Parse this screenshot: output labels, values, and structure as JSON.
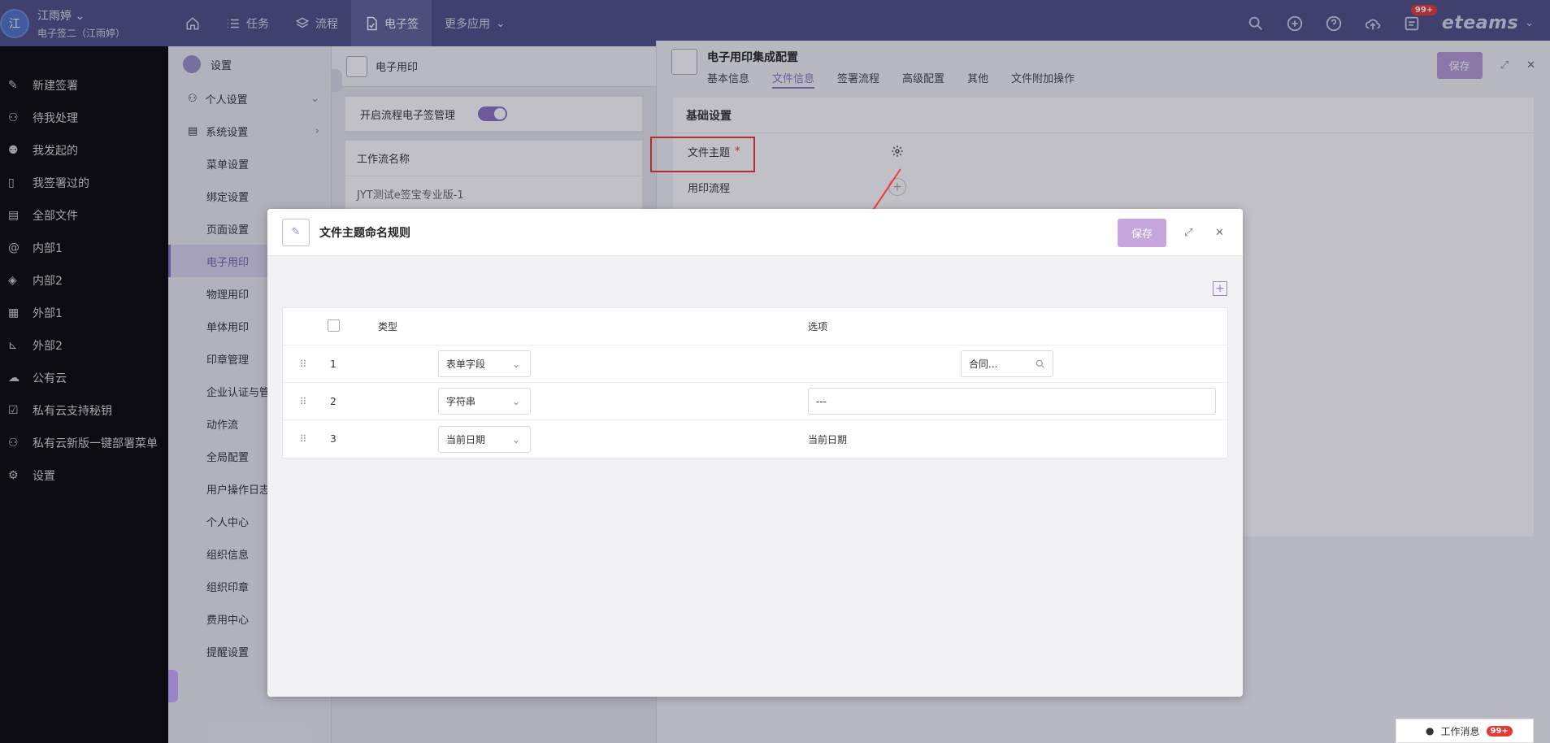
{
  "topbar": {
    "avatar_text": "江",
    "user_name": "江雨婷",
    "org": "电子签二（江雨婷）",
    "nav": [
      "任务",
      "流程",
      "电子签",
      "更多应用"
    ],
    "active_nav": "电子签",
    "badge": "99+",
    "brand": "eteams"
  },
  "sidebar": {
    "items": [
      "新建签署",
      "待我处理",
      "我发起的",
      "我签署过的",
      "全部文件",
      "内部1",
      "内部2",
      "外部1",
      "外部2",
      "公有云",
      "私有云支持秘钥",
      "私有云新版一键部署菜单",
      "设置"
    ]
  },
  "settings": {
    "title": "设置",
    "group_personal": "个人设置",
    "group_system": "系统设置",
    "subs": [
      "菜单设置",
      "绑定设置",
      "页面设置",
      "电子用印",
      "物理用印",
      "单体用印",
      "印章管理",
      "企业认证与管理",
      "动作流",
      "全局配置",
      "用户操作日志",
      "个人中心",
      "组织信息",
      "组织印章",
      "费用中心",
      "提醒设置"
    ],
    "active_sub": "电子用印"
  },
  "middle": {
    "title": "电子用印",
    "toggle_label": "开启流程电子签管理",
    "table_header": "工作流名称",
    "rows": [
      "JYT测试e签宝专业版-1"
    ]
  },
  "right_panel": {
    "title": "电子用印集成配置",
    "tabs": [
      "基本信息",
      "文件信息",
      "签署流程",
      "高级配置",
      "其他",
      "文件附加操作"
    ],
    "active_tab": "文件信息",
    "save": "保存",
    "section": "基础设置",
    "field_subject": "文件主题",
    "required_mark": "*",
    "field_flow": "用印流程"
  },
  "modal": {
    "title": "文件主题命名规则",
    "save": "保存",
    "col_type": "类型",
    "col_option": "选项",
    "rows": [
      {
        "num": "1",
        "type": "表单字段",
        "option": "合同..."
      },
      {
        "num": "2",
        "type": "字符串",
        "option": "---"
      },
      {
        "num": "3",
        "type": "当前日期",
        "option": "当前日期"
      }
    ]
  },
  "message_bar": {
    "label": "工作消息",
    "badge": "99+"
  }
}
